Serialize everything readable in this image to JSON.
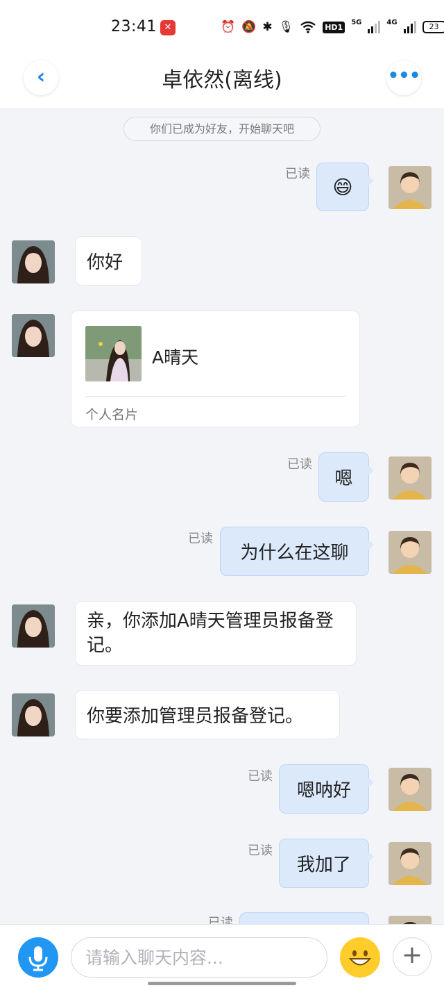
{
  "status_bar": {
    "time": "23:41",
    "icons": [
      "alarm-icon",
      "mute-bell-icon",
      "bluetooth-icon",
      "microphone-icon",
      "wifi-icon",
      "hd-icon",
      "5g-signal-icon",
      "4g-signal-icon",
      "battery-icon"
    ],
    "hd_label": "HD1",
    "net_5g": "5G",
    "net_4g": "4G",
    "battery_level": "23"
  },
  "header": {
    "title": "卓依然(离线)",
    "back_icon": "chevron-left-icon",
    "more_icon": "more-dots-icon"
  },
  "system_notice": "你们已成为好友，开始聊天吧",
  "messages": [
    {
      "side": "out",
      "type": "emoji",
      "content": "😄",
      "status": "已读"
    },
    {
      "side": "in",
      "type": "text",
      "content": "你好"
    },
    {
      "side": "in",
      "type": "card",
      "name": "A晴天",
      "caption": "个人名片"
    },
    {
      "side": "out",
      "type": "text",
      "content": "嗯",
      "status": "已读"
    },
    {
      "side": "out",
      "type": "text",
      "content": "为什么在这聊",
      "status": "已读"
    },
    {
      "side": "in",
      "type": "text",
      "content": "亲，你添加A晴天管理员报备登记。"
    },
    {
      "side": "in",
      "type": "text",
      "content": "你要添加管理员报备登记。"
    },
    {
      "side": "out",
      "type": "text",
      "content": "嗯呐好",
      "status": "已读"
    },
    {
      "side": "out",
      "type": "text",
      "content": "我加了",
      "status": "已读"
    },
    {
      "side": "out",
      "type": "text",
      "content": "",
      "status": "已读"
    }
  ],
  "input_bar": {
    "placeholder": "请输入聊天内容...",
    "mic_icon": "microphone-icon",
    "emoji_icon": "smile-emoji-icon",
    "plus_icon": "plus-icon"
  },
  "colors": {
    "accent": "#2196f3",
    "outgoing_bubble": "#dbe9fb",
    "incoming_bubble": "#ffffff",
    "background": "#f2f4f8",
    "emoji_button": "#ffcd2b"
  }
}
